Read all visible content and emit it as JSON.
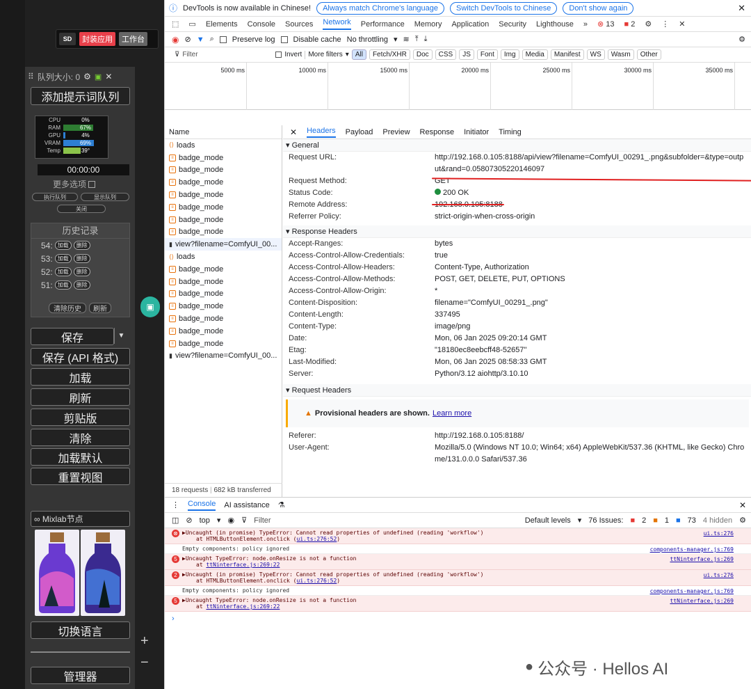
{
  "left": {
    "logo": "SD",
    "btn_app": "封装应用",
    "btn_work": "工作台",
    "queue_label": "队列大小: 0",
    "add_queue": "添加提示词队列",
    "stats": [
      {
        "label": "CPU",
        "value": "0%",
        "frac": 0.0,
        "color": "#2d7fd3"
      },
      {
        "label": "RAM",
        "value": "67%",
        "frac": 0.67,
        "color": "#2e7d32"
      },
      {
        "label": "GPU",
        "value": "4%",
        "frac": 0.04,
        "color": "#2d7fd3"
      },
      {
        "label": "VRAM",
        "value": "69%",
        "frac": 0.69,
        "color": "#2d7fd3"
      },
      {
        "label": "Temp",
        "value": "39°",
        "frac": 0.39,
        "color": "#8bc34a"
      }
    ],
    "timer": "00:00:00",
    "more_options": "更多选项",
    "exec_queue": "执行队列",
    "show_queue": "显示队列",
    "close": "关闭",
    "history_title": "历史记录",
    "history": [
      {
        "num": "54:",
        "load": "加载",
        "del": "删除"
      },
      {
        "num": "53:",
        "load": "加载",
        "del": "删除"
      },
      {
        "num": "52:",
        "load": "加载",
        "del": "删除"
      },
      {
        "num": "51:",
        "load": "加载",
        "del": "删除"
      }
    ],
    "clear_history": "清除历史",
    "refresh_small": "刷新",
    "buttons": [
      "保存",
      "保存 (API 格式)",
      "加载",
      "刷新",
      "剪贴版",
      "清除",
      "加载默认",
      "重置视图"
    ],
    "mixlab": "∞ Mixlab节点",
    "switch_lang": "切换语言",
    "manager": "管理器"
  },
  "devtools": {
    "info_text": "DevTools is now available in Chinese!",
    "info_btn1": "Always match Chrome's language",
    "info_btn2": "Switch DevTools to Chinese",
    "info_btn3": "Don't show again",
    "tabs": [
      "Elements",
      "Console",
      "Sources",
      "Network",
      "Performance",
      "Memory",
      "Application",
      "Security",
      "Lighthouse"
    ],
    "active_tab": "Network",
    "err_count": "13",
    "warn_count": "2",
    "preserve_log": "Preserve log",
    "disable_cache": "Disable cache",
    "throttling": "No throttling",
    "filter_placeholder": "Filter",
    "invert": "Invert",
    "more_filters": "More filters",
    "types": [
      "All",
      "Fetch/XHR",
      "Doc",
      "CSS",
      "JS",
      "Font",
      "Img",
      "Media",
      "Manifest",
      "WS",
      "Wasm",
      "Other"
    ],
    "ticks": [
      "5000 ms",
      "10000 ms",
      "15000 ms",
      "20000 ms",
      "25000 ms",
      "30000 ms",
      "35000 ms"
    ],
    "name_header": "Name",
    "requests": [
      {
        "icon": "xhr",
        "name": "loads"
      },
      {
        "icon": "doc",
        "name": "badge_mode"
      },
      {
        "icon": "doc",
        "name": "badge_mode"
      },
      {
        "icon": "doc",
        "name": "badge_mode"
      },
      {
        "icon": "doc",
        "name": "badge_mode"
      },
      {
        "icon": "doc",
        "name": "badge_mode"
      },
      {
        "icon": "doc",
        "name": "badge_mode"
      },
      {
        "icon": "doc",
        "name": "badge_mode"
      },
      {
        "icon": "img",
        "name": "view?filename=ComfyUI_00..."
      },
      {
        "icon": "xhr",
        "name": "loads"
      },
      {
        "icon": "doc",
        "name": "badge_mode"
      },
      {
        "icon": "doc",
        "name": "badge_mode"
      },
      {
        "icon": "doc",
        "name": "badge_mode"
      },
      {
        "icon": "doc",
        "name": "badge_mode"
      },
      {
        "icon": "doc",
        "name": "badge_mode"
      },
      {
        "icon": "doc",
        "name": "badge_mode"
      },
      {
        "icon": "doc",
        "name": "badge_mode"
      },
      {
        "icon": "img",
        "name": "view?filename=ComfyUI_00..."
      }
    ],
    "footer_requests": "18 requests",
    "footer_transferred": "682 kB transferred",
    "detail_tabs": [
      "Headers",
      "Payload",
      "Preview",
      "Response",
      "Initiator",
      "Timing"
    ],
    "general_title": "▾ General",
    "general": [
      {
        "k": "Request URL:",
        "v": "http://192.168.0.105:8188/api/view?filename=ComfyUI_00291_.png&subfolder=&type=output&rand=0.05807305220146097"
      },
      {
        "k": "Request Method:",
        "v": "GET"
      },
      {
        "k": "Status Code:",
        "v": "200 OK"
      },
      {
        "k": "Remote Address:",
        "v": "192.168.0.105:8188"
      },
      {
        "k": "Referrer Policy:",
        "v": "strict-origin-when-cross-origin"
      }
    ],
    "resp_title": "▾ Response Headers",
    "response": [
      {
        "k": "Accept-Ranges:",
        "v": "bytes"
      },
      {
        "k": "Access-Control-Allow-Credentials:",
        "v": "true"
      },
      {
        "k": "Access-Control-Allow-Headers:",
        "v": "Content-Type, Authorization"
      },
      {
        "k": "Access-Control-Allow-Methods:",
        "v": "POST, GET, DELETE, PUT, OPTIONS"
      },
      {
        "k": "Access-Control-Allow-Origin:",
        "v": "*"
      },
      {
        "k": "Content-Disposition:",
        "v": "filename=\"ComfyUI_00291_.png\""
      },
      {
        "k": "Content-Length:",
        "v": "337495"
      },
      {
        "k": "Content-Type:",
        "v": "image/png"
      },
      {
        "k": "Date:",
        "v": "Mon, 06 Jan 2025 09:20:14 GMT"
      },
      {
        "k": "Etag:",
        "v": "\"18180ec8eebcff48-52657\""
      },
      {
        "k": "Last-Modified:",
        "v": "Mon, 06 Jan 2025 08:58:33 GMT"
      },
      {
        "k": "Server:",
        "v": "Python/3.12 aiohttp/3.10.10"
      }
    ],
    "req_title": "▾ Request Headers",
    "provisional": "Provisional headers are shown.",
    "learn_more": "Learn more",
    "request": [
      {
        "k": "Referer:",
        "v": "http://192.168.0.105:8188/"
      },
      {
        "k": "User-Agent:",
        "v": "Mozilla/5.0 (Windows NT 10.0; Win64; x64) AppleWebKit/537.36 (KHTML, like Gecko) Chrome/131.0.0.0 Safari/537.36"
      }
    ],
    "console_tab": "Console",
    "ai_tab": "AI assistance",
    "top": "top",
    "console_filter": "Filter",
    "default_levels": "Default levels",
    "issues": "76 Issues:",
    "issue_err": "2",
    "issue_warn": "1",
    "issue_info": "73",
    "hidden": "4 hidden",
    "logs": [
      {
        "type": "err",
        "badge": "⊗",
        "l1": "▶Uncaught (in promise) TypeError: Cannot read properties of undefined (reading 'workflow')",
        "l2": "at HTMLButtonElement.onclick (",
        "link": "ui.ts:276:52",
        "tail": ")",
        "src": "ui.ts:276"
      },
      {
        "type": "plain",
        "badge": "",
        "l1": "Empty components: policy ignored",
        "l2": "",
        "link": "",
        "tail": "",
        "src": "components-manager.js:769"
      },
      {
        "type": "err",
        "badge": "5",
        "l1": "▶Uncaught TypeError: node.onResize is not a function",
        "l2": "at ",
        "link": "ttNinterface.js:269:22",
        "tail": "",
        "src": "ttNinterface.js:269"
      },
      {
        "type": "err",
        "badge": "2",
        "l1": "▶Uncaught (in promise) TypeError: Cannot read properties of undefined (reading 'workflow')",
        "l2": "at HTMLButtonElement.onclick (",
        "link": "ui.ts:276:52",
        "tail": ")",
        "src": "ui.ts:276"
      },
      {
        "type": "plain",
        "badge": "",
        "l1": "Empty components: policy ignored",
        "l2": "",
        "link": "",
        "tail": "",
        "src": "components-manager.js:769"
      },
      {
        "type": "err",
        "badge": "5",
        "l1": "▶Uncaught TypeError: node.onResize is not a function",
        "l2": "at ",
        "link": "ttNinterface.js:269:22",
        "tail": "",
        "src": "ttNinterface.js:269"
      }
    ],
    "watermark": "公众号 · Hellos AI"
  }
}
